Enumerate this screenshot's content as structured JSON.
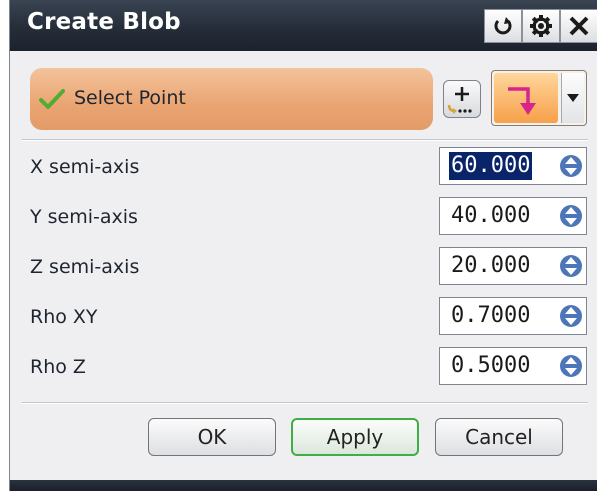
{
  "dialog": {
    "title": "Create Blob",
    "title_icons": [
      "reset-icon",
      "gear-icon",
      "close-icon"
    ]
  },
  "selection": {
    "label": "Select Point",
    "status_icon": "checkmark-icon",
    "status_color": "#4fae32",
    "accent_color": "#e9a370"
  },
  "fields": [
    {
      "label": "X semi-axis",
      "value": "60.000",
      "selected": true
    },
    {
      "label": "Y semi-axis",
      "value": "40.000"
    },
    {
      "label": "Z semi-axis",
      "value": "20.000"
    },
    {
      "label": "Rho XY",
      "value": "0.7000"
    },
    {
      "label": "Rho Z",
      "value": "0.5000"
    }
  ],
  "buttons": {
    "ok": "OK",
    "apply": "Apply",
    "cancel": "Cancel"
  }
}
